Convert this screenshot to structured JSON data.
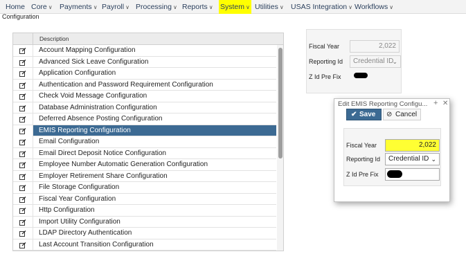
{
  "nav": {
    "items": [
      {
        "label": "Home",
        "caret": false,
        "active": false
      },
      {
        "label": "Core",
        "caret": true,
        "active": false
      },
      {
        "label": "Payments",
        "caret": true,
        "active": false
      },
      {
        "label": "Payroll",
        "caret": true,
        "active": false
      },
      {
        "label": "Processing",
        "caret": true,
        "active": false
      },
      {
        "label": "Reports",
        "caret": true,
        "active": false
      },
      {
        "label": "System",
        "caret": true,
        "active": true
      },
      {
        "label": "Utilities",
        "caret": true,
        "active": false
      },
      {
        "label": "USAS Integration",
        "caret": true,
        "active": false
      },
      {
        "label": "Workflows",
        "caret": true,
        "active": false
      }
    ]
  },
  "breadcrumb": "Configuration",
  "list": {
    "header": "Description",
    "selected_index": 7,
    "items": [
      "Account Mapping Configuration",
      "Advanced Sick Leave Configuration",
      "Application Configuration",
      "Authentication and Password Requirement Configuration",
      "Check Void Message Configuration",
      "Database Administration Configuration",
      "Deferred Absence Posting Configuration",
      "EMIS Reporting Configuration",
      "Email Configuration",
      "Email Direct Deposit Notice Configuration",
      "Employee Number Automatic Generation Configuration",
      "Employer Retirement Share Configuration",
      "File Storage Configuration",
      "Fiscal Year Configuration",
      "Http Configuration",
      "Import Utility Configuration",
      "LDAP Directory Authentication",
      "Last Account Transition Configuration"
    ]
  },
  "detail": {
    "fiscal_year_label": "Fiscal Year",
    "fiscal_year_value": "2,022",
    "reporting_id_label": "Reporting Id",
    "reporting_id_value": "Credential ID",
    "z_id_label": "Z Id Pre Fix"
  },
  "dialog": {
    "title": "Edit EMIS Reporting Configu...",
    "save_label": "Save",
    "cancel_label": "Cancel",
    "fiscal_year_label": "Fiscal Year",
    "fiscal_year_value": "2,022",
    "reporting_id_label": "Reporting Id",
    "reporting_id_value": "Credential ID",
    "z_id_label": "Z Id Pre Fix"
  },
  "colors": {
    "accent": "#3c6a93",
    "highlight": "#ffff00"
  },
  "icons": {
    "row_icon": "edit-icon",
    "select_icon": "chevron-down-icon",
    "save_icon": "checkmark-icon",
    "cancel_icon": "cancel-icon",
    "close_icon": "close-icon",
    "pin_icon": "plus-icon"
  }
}
